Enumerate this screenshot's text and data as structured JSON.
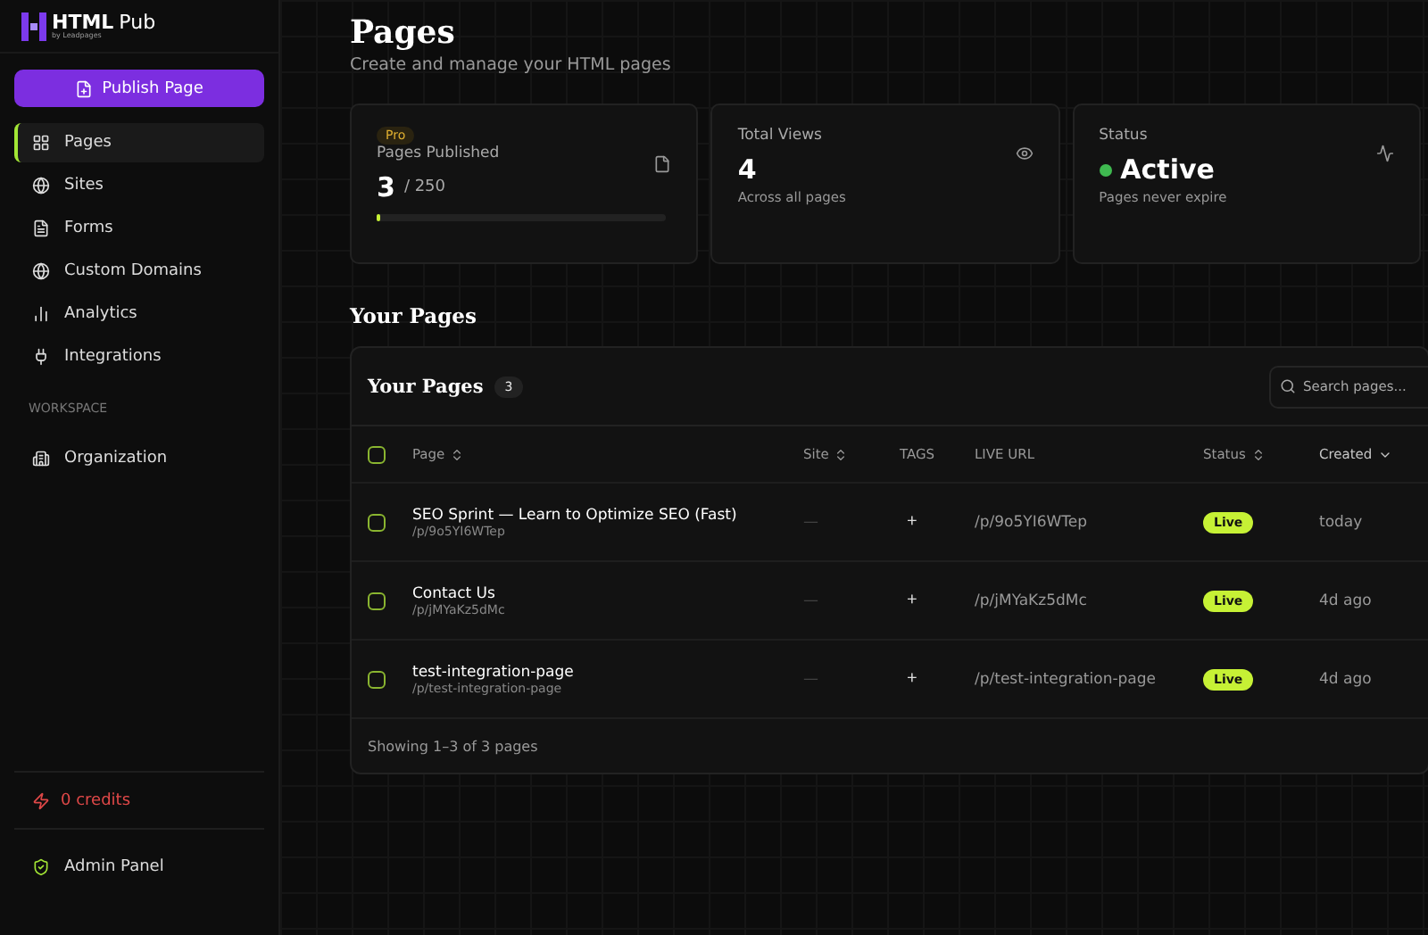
{
  "brand": {
    "name": "HTML",
    "suffix": "Pub",
    "byline": "by Leadpages"
  },
  "publish_button": "Publish Page",
  "nav": [
    {
      "label": "Pages",
      "selected": true
    },
    {
      "label": "Sites",
      "selected": false
    },
    {
      "label": "Forms",
      "selected": false
    },
    {
      "label": "Custom Domains",
      "selected": false
    },
    {
      "label": "Analytics",
      "selected": false
    },
    {
      "label": "Integrations",
      "selected": false
    }
  ],
  "workspace": {
    "heading": "WORKSPACE",
    "items": [
      {
        "label": "Organization",
        "selected": false
      }
    ]
  },
  "credits": "0 credits",
  "admin_panel": "Admin Panel",
  "header": {
    "title": "Pages",
    "subtitle": "Create and manage your HTML pages"
  },
  "stats": {
    "pages_published": {
      "badge": "Pro",
      "label": "Pages Published",
      "value": "3",
      "total": "/ 250",
      "level": 0.012
    },
    "total_views": {
      "label": "Total Views",
      "value": "4",
      "caption": "Across all pages"
    },
    "status": {
      "label": "Status",
      "value": "Active",
      "caption": "Pages never expire",
      "active": true
    }
  },
  "section_title": "Your Pages",
  "table": {
    "title": "Your Pages",
    "count": "3",
    "search": {
      "placeholder": "Search pages..."
    },
    "all_checked": false,
    "columns": [
      {
        "label": "Page",
        "sortable": true,
        "sorted": false
      },
      {
        "label": "Site",
        "sortable": true,
        "sorted": false
      },
      {
        "label": "TAGS",
        "sortable": false,
        "sorted": false
      },
      {
        "label": "LIVE URL",
        "sortable": false,
        "sorted": false
      },
      {
        "label": "Status",
        "sortable": true,
        "sorted": false
      },
      {
        "label": "Created",
        "sortable": true,
        "sorted": true
      }
    ],
    "rows": [
      {
        "checked": false,
        "title": "SEO Sprint — Learn to Optimize SEO (Fast)",
        "path": "/p/9o5YI6WTep",
        "site": "—",
        "tags": "+",
        "url": "/p/9o5YI6WTep",
        "status": "Live",
        "created": "today"
      },
      {
        "checked": false,
        "title": "Contact Us",
        "path": "/p/jMYaKz5dMc",
        "site": "—",
        "tags": "+",
        "url": "/p/jMYaKz5dMc",
        "status": "Live",
        "created": "4d ago"
      },
      {
        "checked": false,
        "title": "test-integration-page",
        "path": "/p/test-integration-page",
        "site": "—",
        "tags": "+",
        "url": "/p/test-integration-page",
        "status": "Live",
        "created": "4d ago"
      }
    ],
    "footer": "Showing 1–3 of 3 pages"
  }
}
